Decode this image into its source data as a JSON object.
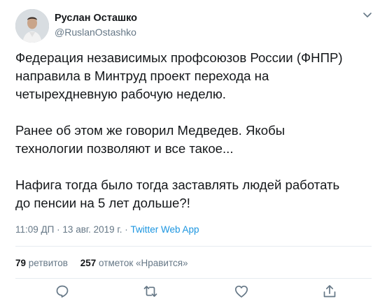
{
  "author": {
    "name": "Руслан Осташко",
    "handle": "@RuslanOstashko"
  },
  "tweet": {
    "paragraphs": [
      [
        "Федерация независимых профсоюзов России (ФНПР)",
        "направила в Минтруд проект перехода на",
        "четырехдневную рабочую неделю."
      ],
      [
        "Ранее об этом же говорил Медведев. Якобы",
        "технологии позволяют и все такое..."
      ],
      [
        "Нафига тогда было тогда заставлять людей работать",
        "до пенсии на 5 лет дольше?!"
      ]
    ]
  },
  "meta": {
    "time": "11:09 ДП",
    "separator": "·",
    "date": "13 авг. 2019 г.",
    "source": "Twitter Web App"
  },
  "stats": {
    "retweets_count": "79",
    "retweets_label": "ретвитов",
    "likes_count": "257",
    "likes_label": "отметок «Нравится»"
  },
  "colors": {
    "text": "#14171a",
    "secondary": "#657786",
    "link": "#1b95e0",
    "divider": "#e6ecf0"
  },
  "icons": {
    "menu": "chevron-down-icon",
    "reply": "reply-icon",
    "retweet": "retweet-icon",
    "like": "heart-icon",
    "share": "share-icon"
  }
}
